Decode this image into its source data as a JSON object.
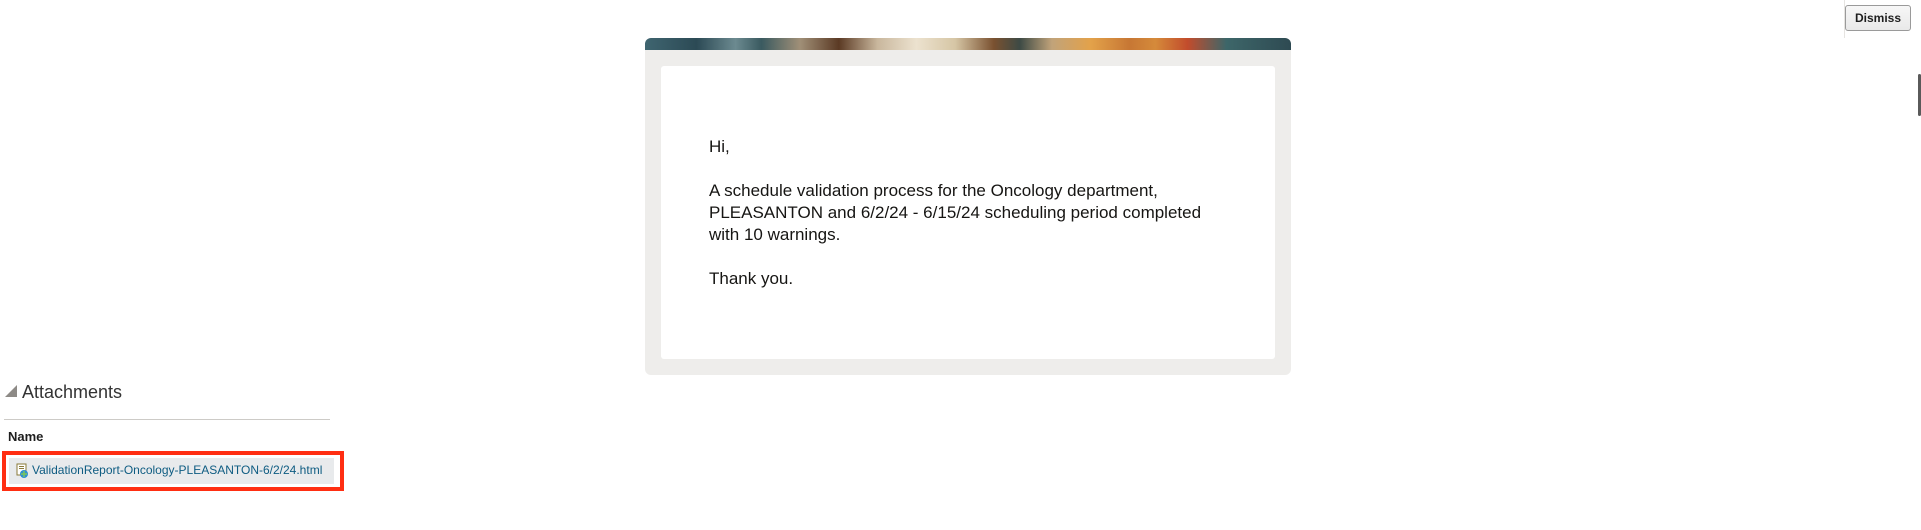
{
  "toolbar": {
    "dismiss_label": "Dismiss"
  },
  "email": {
    "greeting": "Hi,",
    "body": "A schedule validation process for the Oncology department, PLEASANTON and 6/2/24 - 6/15/24 scheduling period completed with 10 warnings.",
    "closing": "Thank you."
  },
  "attachments": {
    "title": "Attachments",
    "column_name": "Name",
    "items": [
      {
        "file_name": "ValidationReport-Oncology-PLEASANTON-6/2/24.html",
        "icon": "html-file-icon"
      }
    ]
  },
  "colors": {
    "highlight": "#ff2e12",
    "link": "#0e5c82",
    "card_bg": "#eeedeb"
  }
}
